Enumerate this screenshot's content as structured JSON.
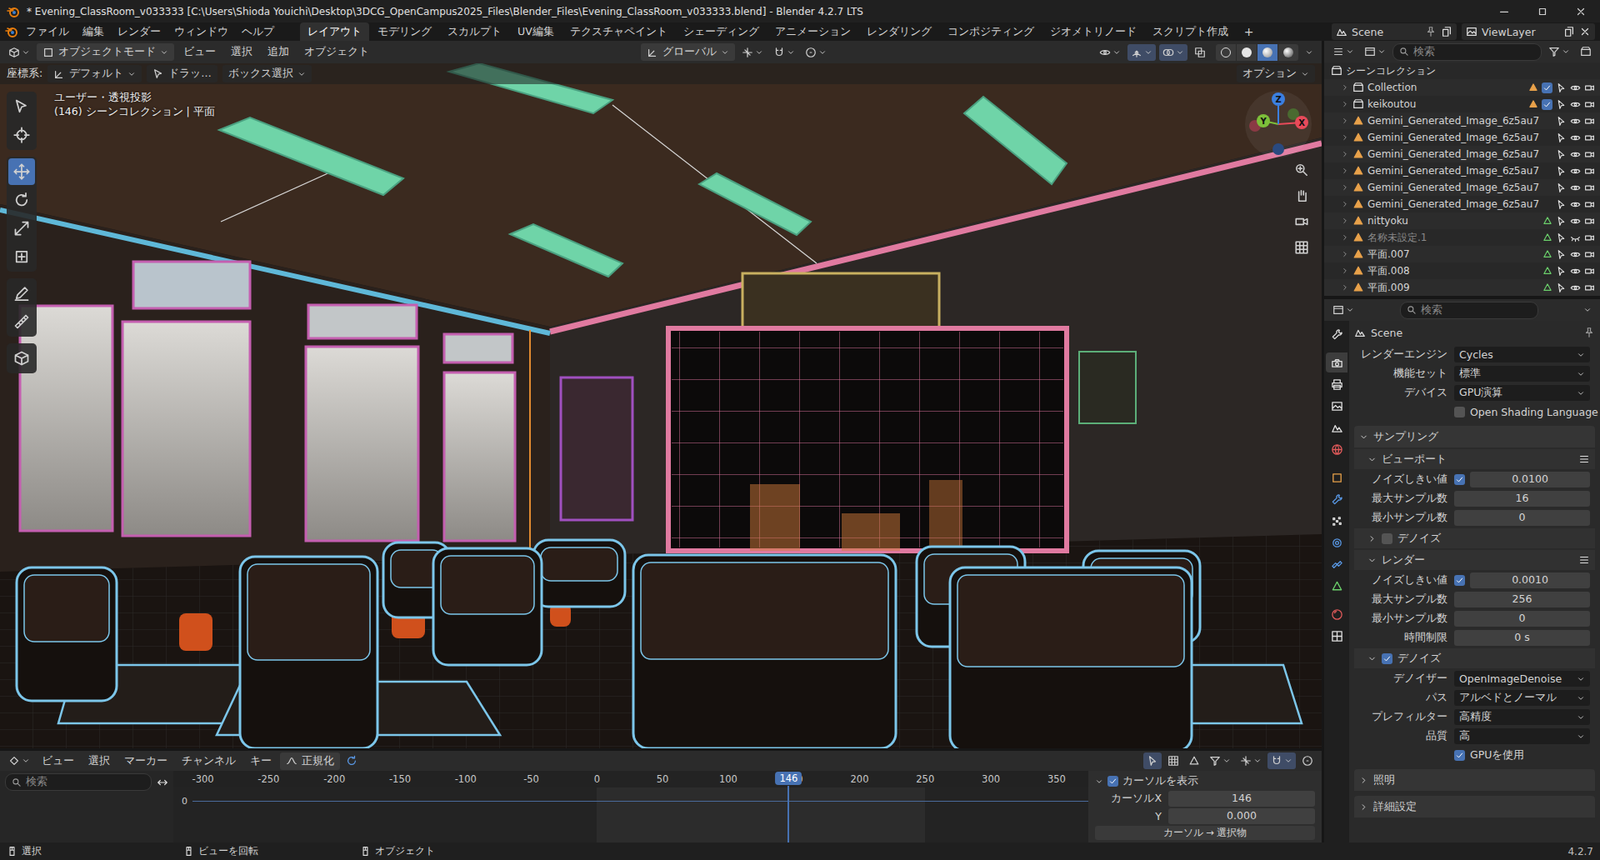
{
  "window": {
    "title": "* Evening_ClassRoom_v033333 [C:\\Users\\Shioda Youichi\\Desktop\\3DCG_OpenCampus2025_Files\\Blender_Files\\Evening_ClassRoom_v033333.blend] - Blender 4.2.7 LTS"
  },
  "menu": [
    "ファイル",
    "編集",
    "レンダー",
    "ウィンドウ",
    "ヘルプ"
  ],
  "workspaces": [
    {
      "label": "レイアウト",
      "selected": true
    },
    {
      "label": "モデリング",
      "selected": false
    },
    {
      "label": "スカルプト",
      "selected": false
    },
    {
      "label": "UV編集",
      "selected": false
    },
    {
      "label": "テクスチャペイント",
      "selected": false
    },
    {
      "label": "シェーディング",
      "selected": false
    },
    {
      "label": "アニメーション",
      "selected": false
    },
    {
      "label": "レンダリング",
      "selected": false
    },
    {
      "label": "コンポジティング",
      "selected": false
    },
    {
      "label": "ジオメトリノード",
      "selected": false
    },
    {
      "label": "スクリプト作成",
      "selected": false
    }
  ],
  "add_workspace": "+",
  "scene": "Scene",
  "view_layer": "ViewLayer",
  "viewport": {
    "mode": "オブジェクトモード",
    "menus": [
      "ビュー",
      "選択",
      "追加",
      "オブジェクト"
    ],
    "orientation": "グローバル",
    "coord_label": "座標系:",
    "coord_value": "デフォルト",
    "drag": "ドラッ…",
    "select_mode": "ボックス選択",
    "options": "オプション",
    "view_name": "ユーザー・透視投影",
    "view_info": "(146) シーンコレクション | 平面",
    "axes": [
      "X",
      "Y",
      "Z"
    ],
    "tools": [
      {
        "selected": false
      },
      {
        "selected": false
      },
      {
        "selected": true
      },
      {
        "selected": false
      },
      {
        "selected": false
      },
      {
        "selected": false
      },
      {
        "selected": false
      },
      {
        "selected": false
      },
      {
        "selected": false
      }
    ],
    "shading": [
      {
        "selected": false
      },
      {
        "selected": false
      },
      {
        "selected": true
      },
      {
        "selected": false
      }
    ]
  },
  "outliner": {
    "search": "検索",
    "root": "シーンコレクション",
    "items": [
      {
        "name": "Collection",
        "kind": "collection",
        "expanded": false,
        "checked": true,
        "visible": true,
        "disabled": false
      },
      {
        "name": "keikoutou",
        "kind": "collection",
        "expanded": false,
        "checked": true,
        "visible": true,
        "disabled": false
      },
      {
        "name": "Gemini_Generated_Image_6z5au7",
        "kind": "object",
        "expanded": false,
        "checked": false,
        "visible": true,
        "disabled": false
      },
      {
        "name": "Gemini_Generated_Image_6z5au7",
        "kind": "object",
        "expanded": false,
        "checked": false,
        "visible": true,
        "disabled": false
      },
      {
        "name": "Gemini_Generated_Image_6z5au7",
        "kind": "object",
        "expanded": false,
        "checked": false,
        "visible": true,
        "disabled": false
      },
      {
        "name": "Gemini_Generated_Image_6z5au7",
        "kind": "object",
        "expanded": false,
        "checked": false,
        "visible": true,
        "disabled": false
      },
      {
        "name": "Gemini_Generated_Image_6z5au7",
        "kind": "object",
        "expanded": false,
        "checked": false,
        "visible": true,
        "disabled": false
      },
      {
        "name": "Gemini_Generated_Image_6z5au7",
        "kind": "object",
        "expanded": false,
        "checked": false,
        "visible": true,
        "disabled": false
      },
      {
        "name": "nittyoku",
        "kind": "mesh",
        "expanded": false,
        "checked": false,
        "visible": true,
        "disabled": false
      },
      {
        "name": "名称未設定.1",
        "kind": "mesh",
        "expanded": false,
        "checked": false,
        "visible": false,
        "disabled": true
      },
      {
        "name": "平面.007",
        "kind": "mesh",
        "expanded": false,
        "checked": false,
        "visible": true,
        "disabled": false
      },
      {
        "name": "平面.008",
        "kind": "mesh",
        "expanded": false,
        "checked": false,
        "visible": true,
        "disabled": false
      },
      {
        "name": "平面.009",
        "kind": "mesh",
        "expanded": false,
        "checked": false,
        "visible": true,
        "disabled": false
      }
    ]
  },
  "properties": {
    "search": "検索",
    "context": "Scene",
    "tabs": [
      {
        "selected": false
      },
      {
        "selected": true
      },
      {
        "selected": false
      },
      {
        "selected": false
      },
      {
        "selected": false
      },
      {
        "selected": false
      },
      {
        "selected": false
      },
      {
        "selected": false
      },
      {
        "selected": false
      },
      {
        "selected": false
      },
      {
        "selected": false
      },
      {
        "selected": false
      },
      {
        "selected": false
      },
      {
        "selected": false
      }
    ],
    "rows": [
      {
        "kind": "dropdown",
        "label": "レンダーエンジン",
        "value": "Cycles"
      },
      {
        "kind": "dropdown",
        "label": "機能セット",
        "value": "標準"
      },
      {
        "kind": "dropdown",
        "label": "デバイス",
        "value": "GPU演算"
      },
      {
        "kind": "checkbox",
        "label": "Open Shading Language",
        "checked": false
      },
      {
        "kind": "panel",
        "label": "サンプリング",
        "expanded": true
      },
      {
        "kind": "subpanel",
        "label": "ビューポート",
        "expanded": true,
        "presets": true
      },
      {
        "kind": "toggle-number",
        "label": "ノイズしきい値",
        "checked": true,
        "value": "0.0100"
      },
      {
        "kind": "number",
        "label": "最大サンプル数",
        "value": "16"
      },
      {
        "kind": "number",
        "label": "最小サンプル数",
        "value": "0"
      },
      {
        "kind": "subpanel-check",
        "label": "デノイズ",
        "expanded": false,
        "checked": false
      },
      {
        "kind": "subpanel",
        "label": "レンダー",
        "expanded": true,
        "presets": true
      },
      {
        "kind": "toggle-number",
        "label": "ノイズしきい値",
        "checked": true,
        "value": "0.0010"
      },
      {
        "kind": "number",
        "label": "最大サンプル数",
        "value": "256"
      },
      {
        "kind": "number",
        "label": "最小サンプル数",
        "value": "0"
      },
      {
        "kind": "number",
        "label": "時間制限",
        "value": "0 s"
      },
      {
        "kind": "subpanel-check",
        "label": "デノイズ",
        "expanded": true,
        "checked": true
      },
      {
        "kind": "dropdown",
        "label": "デノイザー",
        "value": "OpenImageDenoise"
      },
      {
        "kind": "dropdown",
        "label": "パス",
        "value": "アルベドとノーマル"
      },
      {
        "kind": "dropdown",
        "label": "プレフィルター",
        "value": "高精度"
      },
      {
        "kind": "dropdown",
        "label": "品質",
        "value": "高"
      },
      {
        "kind": "checkbox",
        "label": "GPUを使用",
        "checked": true
      },
      {
        "kind": "panel",
        "label": "照明",
        "expanded": false
      },
      {
        "kind": "panel",
        "label": "詳細設定",
        "expanded": false
      }
    ]
  },
  "timeline": {
    "menus": [
      "ビュー",
      "選択",
      "マーカー",
      "チャンネル",
      "キー"
    ],
    "normalize": {
      "label": "正規化",
      "checked": false
    },
    "search": "検索",
    "ticks": [
      "-300",
      "-250",
      "-200",
      "-150",
      "-100",
      "-50",
      "0",
      "50",
      "100",
      "150",
      "200",
      "250",
      "300",
      "350"
    ],
    "current_frame": "146",
    "frame_range": [
      0,
      250
    ],
    "summary": "0",
    "sidebar": {
      "show_cursor": {
        "label": "カーソルを表示",
        "checked": true
      },
      "fields": [
        {
          "label": "カーソルX",
          "value": "146"
        },
        {
          "label": "Y",
          "value": "0.000"
        }
      ],
      "button": "カーソル → 選択物"
    }
  },
  "status_bar": {
    "items": [
      "選択",
      "ビューを回転",
      "オブジェクト"
    ],
    "version": "4.2.7"
  }
}
